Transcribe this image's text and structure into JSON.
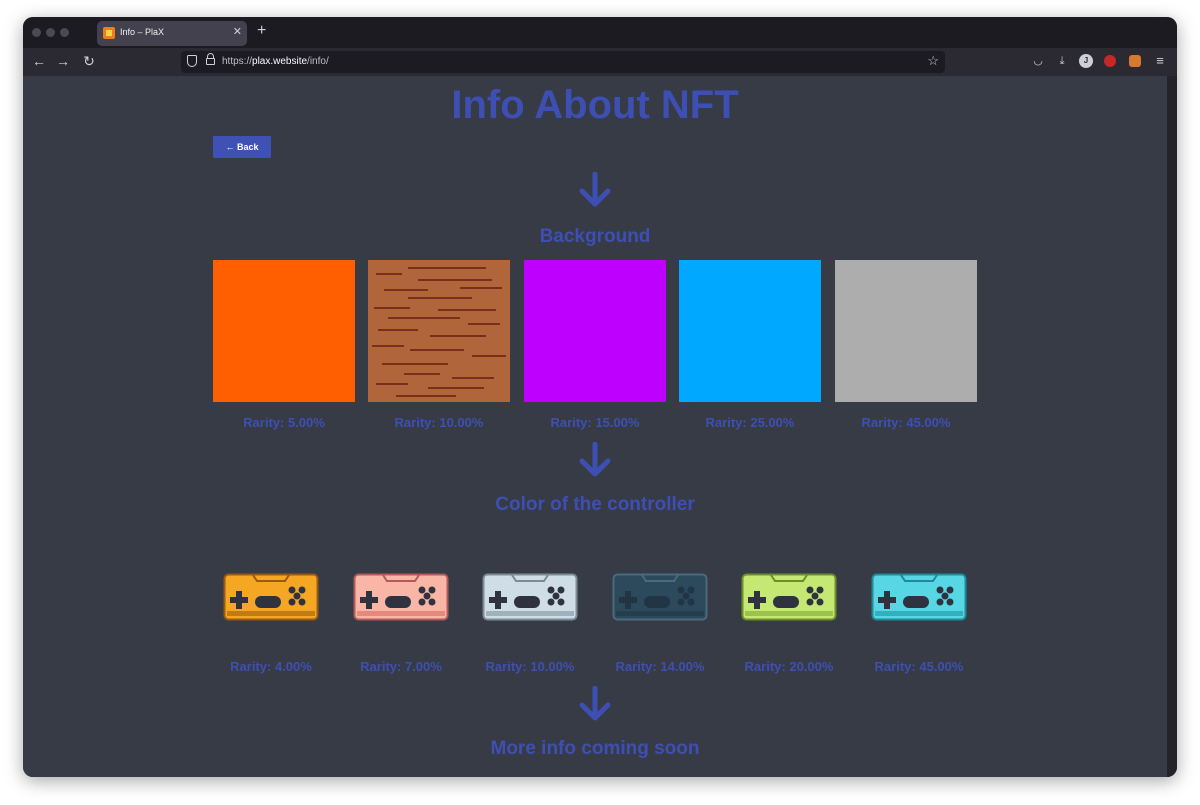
{
  "browser": {
    "tab_title": "Info – PlaX",
    "url_scheme": "https://",
    "url_host": "plax.website",
    "url_path": "/info/"
  },
  "page": {
    "heading": "Info About NFT",
    "back_label": "Back",
    "sections": {
      "background_title": "Background",
      "controller_title": "Color of the controller",
      "more_title": "More info coming soon"
    },
    "backgrounds": [
      {
        "color": "#ff5f00",
        "rarity": "Rarity: 5.00%"
      },
      {
        "color": "wood",
        "rarity": "Rarity: 10.00%"
      },
      {
        "color": "#bd00ff",
        "rarity": "Rarity: 15.00%"
      },
      {
        "color": "#00a8ff",
        "rarity": "Rarity: 25.00%"
      },
      {
        "color": "#adadad",
        "rarity": "Rarity: 45.00%"
      }
    ],
    "controllers": [
      {
        "color": "#f5a623",
        "rarity": "Rarity: 4.00%"
      },
      {
        "color": "#f9b5a6",
        "rarity": "Rarity: 7.00%"
      },
      {
        "color": "#cfdde6",
        "rarity": "Rarity: 10.00%"
      },
      {
        "color": "#2c4a5c",
        "rarity": "Rarity: 14.00%"
      },
      {
        "color": "#c5e872",
        "rarity": "Rarity: 20.00%"
      },
      {
        "color": "#57d6e4",
        "rarity": "Rarity: 45.00%"
      }
    ],
    "accent_color": "#3f51b5"
  }
}
